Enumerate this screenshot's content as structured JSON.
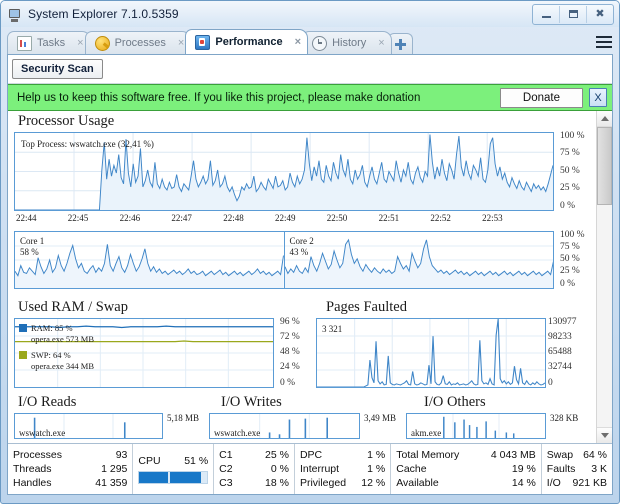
{
  "window": {
    "title": "System Explorer 7.1.0.5359",
    "app_icon": "monitor-icon",
    "minimize": "minimize-icon",
    "maximize": "maximize-icon",
    "close": "close-icon"
  },
  "tabs": [
    {
      "label": "Tasks",
      "icon": "tasks-icon",
      "close": "×",
      "active": false
    },
    {
      "label": "Processes",
      "icon": "processes-icon",
      "close": "×",
      "active": false
    },
    {
      "label": "Performance",
      "icon": "performance-icon",
      "close": "×",
      "active": true
    },
    {
      "label": "History",
      "icon": "history-icon",
      "close": "×",
      "active": false
    }
  ],
  "tab_add": "add-tab-icon",
  "menu_icon": "hamburger-menu-icon",
  "toolbar": {
    "security_scan": "Security Scan"
  },
  "banner": {
    "text": "Help us to keep this software free.  If you like this project, please make donation",
    "donate_label": "Donate",
    "close_label": "X",
    "background": "#7cf07c"
  },
  "chart_data": [
    {
      "type": "line",
      "title": "Processor Usage",
      "annotation": "Top Process: wswatch.exe (32,41 %)",
      "ylabel": "",
      "yticks": [
        "100 %",
        "75 %",
        "50 %",
        "25 %",
        "0 %"
      ],
      "ylim": [
        0,
        100
      ],
      "xticks": [
        "22:44",
        "22:45",
        "22:46",
        "22:47",
        "22:48",
        "22:49",
        "22:50",
        "22:51",
        "22:52",
        "22:53"
      ],
      "color": "#3f86c8",
      "fill": "#eaf3fb",
      "grid": true,
      "values": [
        0,
        0,
        0,
        0,
        0,
        0,
        0,
        0,
        0,
        0,
        0,
        0,
        0,
        0,
        0,
        0,
        0,
        0,
        0,
        0,
        0,
        0,
        0,
        0,
        0,
        0,
        0,
        0,
        0,
        0,
        0,
        0,
        0,
        0,
        0,
        0,
        52,
        88,
        40,
        66,
        44,
        58,
        48,
        72,
        42,
        34,
        92,
        48,
        30,
        60,
        36,
        44,
        80,
        30,
        38,
        52,
        36,
        30,
        62,
        34,
        28,
        40,
        30,
        26,
        36,
        28,
        30,
        46,
        30,
        24,
        34,
        30,
        26,
        44,
        64,
        40,
        30,
        36,
        44,
        34,
        40,
        64,
        32,
        38,
        52,
        30,
        34,
        44,
        30,
        24,
        30,
        20,
        12,
        18,
        30,
        26,
        34,
        28,
        30,
        44,
        24,
        28,
        36,
        30,
        26,
        40,
        34,
        28,
        44,
        30,
        32,
        38,
        26,
        30,
        48,
        36,
        30,
        44,
        34,
        40,
        52,
        94,
        60,
        38,
        56,
        44,
        64,
        40,
        36,
        58,
        44,
        38,
        62,
        48,
        40,
        72,
        52,
        44,
        66,
        40,
        34,
        52,
        40,
        46,
        58,
        36,
        30,
        44,
        56,
        40,
        34,
        48,
        62,
        40,
        36,
        50,
        44,
        38,
        64,
        48,
        36,
        52,
        44,
        62,
        40,
        34,
        48,
        56,
        42,
        36,
        50,
        44,
        98,
        62,
        40,
        56,
        44,
        66,
        48,
        38,
        60,
        52,
        40,
        72,
        96,
        56,
        44,
        64,
        48,
        40,
        58,
        52,
        44,
        68,
        40,
        36,
        52,
        86,
        94,
        60,
        44,
        56,
        40,
        48,
        36,
        30,
        42,
        34,
        28,
        38,
        30,
        26,
        36,
        30,
        24,
        34,
        28,
        32,
        26,
        30,
        24,
        34,
        46,
        58
      ]
    },
    {
      "type": "line",
      "title": "Core 1",
      "label": "Core 1",
      "value_text": "58 %",
      "yticks": [
        "100 %",
        "75 %",
        "50 %",
        "25 %",
        "0 %"
      ],
      "ylim": [
        0,
        100
      ],
      "color": "#3f86c8",
      "fill": "#eef5fc",
      "values": [
        30,
        22,
        40,
        28,
        26,
        36,
        30,
        24,
        54,
        38,
        26,
        34,
        50,
        28,
        36,
        58,
        40,
        30,
        44,
        62,
        76,
        52,
        36,
        44,
        30,
        26,
        34,
        40,
        28,
        36,
        30,
        44,
        78,
        40,
        30,
        44,
        56,
        36,
        28,
        40,
        60,
        44,
        30,
        38,
        52,
        70,
        44,
        30,
        38,
        28,
        34,
        26,
        30,
        24,
        28,
        32,
        26,
        30,
        24,
        28,
        34,
        26,
        30,
        24,
        26,
        30,
        22,
        26,
        30,
        24,
        28,
        32,
        24,
        28,
        22,
        26,
        30,
        24,
        28,
        22,
        26,
        30,
        24,
        28,
        34,
        26,
        30,
        24,
        28,
        22,
        26,
        30,
        24,
        58
      ]
    },
    {
      "type": "line",
      "title": "Core 2",
      "label": "Core 2",
      "value_text": "43 %",
      "yticks": [
        "100 %",
        "75 %",
        "50 %",
        "25 %",
        "0 %"
      ],
      "ylim": [
        0,
        100
      ],
      "color": "#3f86c8",
      "fill": "#eef5fc",
      "values": [
        38,
        26,
        34,
        28,
        40,
        30,
        26,
        36,
        28,
        56,
        40,
        30,
        44,
        62,
        48,
        34,
        42,
        66,
        50,
        36,
        44,
        78,
        86,
        60,
        44,
        52,
        38,
        30,
        42,
        34,
        28,
        36,
        30,
        26,
        34,
        28,
        32,
        26,
        30,
        56,
        44,
        34,
        40,
        30,
        62,
        48,
        36,
        44,
        70,
        86,
        56,
        40,
        34,
        28,
        32,
        26,
        30,
        24,
        28,
        32,
        26,
        30,
        24,
        28,
        22,
        26,
        30,
        24,
        28,
        22,
        26,
        30,
        24,
        28,
        22,
        26,
        30,
        24,
        28,
        22,
        26,
        30,
        24,
        28,
        22,
        26,
        30,
        24,
        28,
        22,
        26,
        30,
        24,
        48
      ]
    },
    {
      "type": "line",
      "title": "Used RAM / Swap",
      "yticks": [
        "96 %",
        "72 %",
        "48 %",
        "24 %",
        "0 %"
      ],
      "ylim": [
        0,
        96
      ],
      "grid": true,
      "legend": [
        {
          "name": "RAM: 85 %",
          "detail": "opera.exe 573 MB",
          "color": "#1f6fb8"
        },
        {
          "name": "SWP: 64 %",
          "detail": "opera.exe 344 MB",
          "color": "#9aa81c"
        }
      ],
      "series": [
        {
          "name": "RAM",
          "color": "#1f6fb8",
          "values": [
            85,
            85,
            85,
            85,
            85,
            84,
            85,
            85,
            86,
            85,
            85,
            85,
            84,
            85,
            85,
            85,
            85,
            86,
            85,
            85,
            85,
            85,
            85,
            85,
            85,
            85,
            85,
            85,
            85,
            85
          ]
        },
        {
          "name": "SWP",
          "color": "#9aa81c",
          "values": [
            64,
            64,
            64,
            64,
            64,
            64,
            64,
            64,
            64,
            64,
            64,
            64,
            64,
            64,
            64,
            64,
            64,
            64,
            64,
            65,
            64,
            64,
            64,
            64,
            64,
            64,
            64,
            64,
            64,
            64
          ]
        }
      ]
    },
    {
      "type": "line",
      "title": "Pages Faulted",
      "annotation": "3 321",
      "yticks": [
        "130977",
        "98233",
        "65488",
        "32744",
        "0"
      ],
      "ylim": [
        0,
        130977
      ],
      "color": "#3f86c8",
      "values": [
        0,
        0,
        0,
        0,
        0,
        0,
        0,
        0,
        0,
        0,
        0,
        0,
        0,
        0,
        0,
        0,
        0,
        0,
        0,
        0,
        0,
        0,
        0,
        0,
        2000,
        4000,
        52000,
        18000,
        8000,
        88000,
        12000,
        6000,
        10000,
        4000,
        5000,
        60000,
        8000,
        5000,
        4000,
        6000,
        5000,
        4000,
        6000,
        8000,
        12000,
        5000,
        4000,
        30000,
        6000,
        4000,
        5000,
        8000,
        6000,
        4000,
        5000,
        42000,
        6000,
        98000,
        10000,
        5000,
        4000,
        8000,
        22000,
        6000,
        5000,
        10000,
        4000,
        6000,
        5000,
        8000,
        4000,
        5000,
        6000,
        4000,
        5000,
        8000,
        12000,
        6000,
        4000,
        5000,
        90000,
        12000,
        6000,
        8000,
        5000,
        16000,
        6000,
        4000,
        100000,
        130977,
        16000,
        8000,
        12000,
        6000,
        10000,
        5000,
        8000,
        40000,
        14000,
        6000,
        36000,
        8000,
        5000,
        12000,
        6000,
        4000,
        8000,
        5000,
        10000,
        6000,
        4000,
        5000,
        8000
      ]
    },
    {
      "type": "bar",
      "title": "I/O Reads",
      "value_text": "5,18 MB",
      "process_label": "wswatch.exe",
      "color": "#3f86c8"
    },
    {
      "type": "bar",
      "title": "I/O Writes",
      "value_text": "3,49 MB",
      "process_label": "wswatch.exe",
      "color": "#3f86c8"
    },
    {
      "type": "bar",
      "title": "I/O Others",
      "value_text": "328 KB",
      "process_label": "akm.exe",
      "color": "#3f86c8"
    }
  ],
  "status": {
    "group1": [
      {
        "k": "Processes",
        "v": "93"
      },
      {
        "k": "Threads",
        "v": "1 295"
      },
      {
        "k": "Handles",
        "v": "41 359"
      }
    ],
    "cpu": {
      "label": "CPU",
      "value": "51 %",
      "percent": 51
    },
    "group3": [
      {
        "k": "C1",
        "v": "25 %"
      },
      {
        "k": "C2",
        "v": "0 %"
      },
      {
        "k": "C3",
        "v": "18 %"
      }
    ],
    "group4": [
      {
        "k": "DPC",
        "v": "1 %"
      },
      {
        "k": "Interrupt",
        "v": "1 %"
      },
      {
        "k": "Privileged",
        "v": "12 %"
      }
    ],
    "group5": [
      {
        "k": "Total Memory",
        "v": "4 043 MB"
      },
      {
        "k": "Cache",
        "v": "19 %"
      },
      {
        "k": "Available",
        "v": "14 %"
      }
    ],
    "group6": [
      {
        "k": "Swap",
        "v": "64 %"
      },
      {
        "k": "Faults",
        "v": "3 K"
      },
      {
        "k": "I/O",
        "v": "921 KB"
      }
    ]
  },
  "scrollbar": {
    "up": "scroll-up-icon",
    "down": "scroll-down-icon"
  }
}
